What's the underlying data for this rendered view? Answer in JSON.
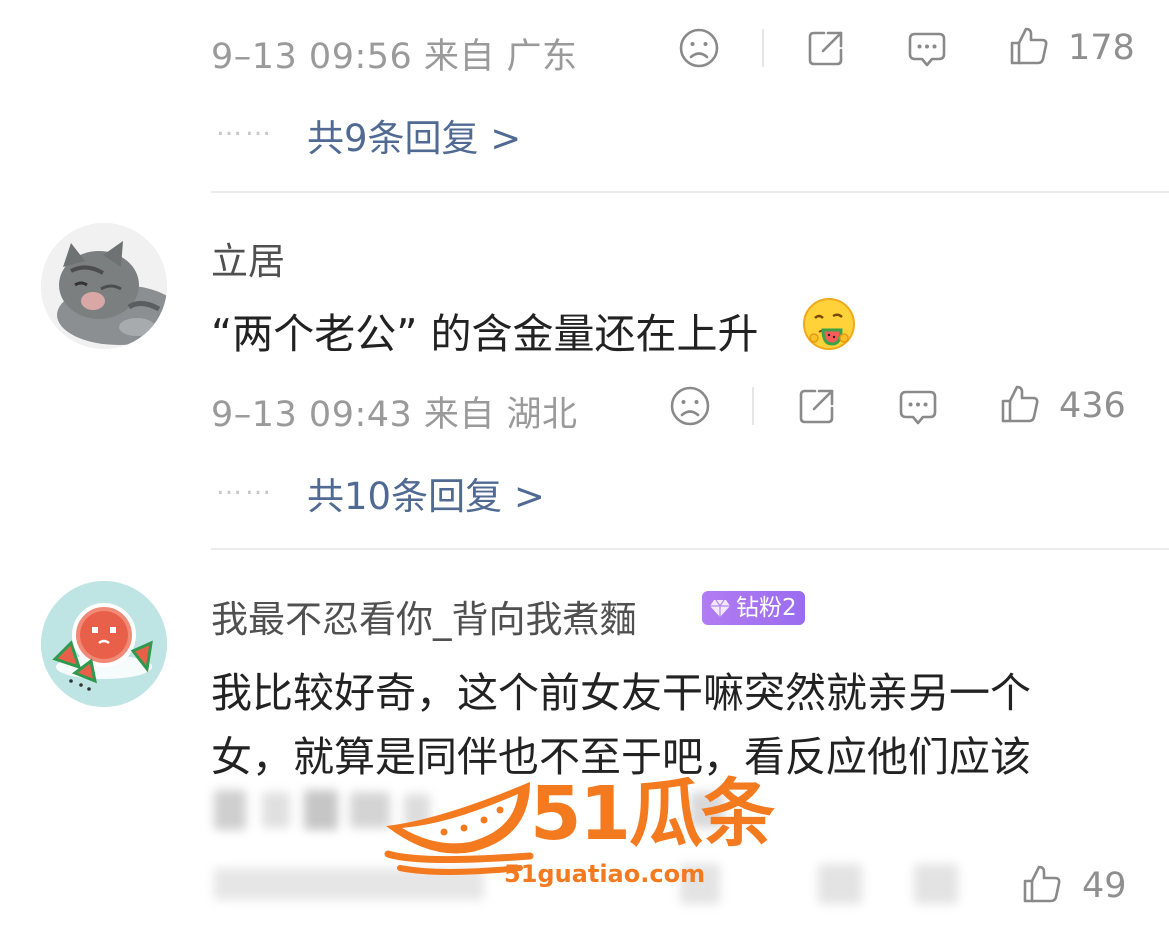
{
  "comments": [
    {
      "meta": "9–13 09:56 来自 广东",
      "like_count": "178",
      "replies_label": "共9条回复 >",
      "dots": "……"
    },
    {
      "username": "立居",
      "content": "“两个老公” 的含金量还在上升",
      "emoji": "watermelon-eating-emoji",
      "meta": "9–13 09:43 来自 湖北",
      "like_count": "436",
      "replies_label": "共10条回复 >",
      "dots": "……"
    },
    {
      "username": "我最不忍看你_背向我煮麵",
      "badge": "钻粉2",
      "content_line1": "我比较好奇，这个前女友干嘛突然就亲另一个",
      "content_line2": "女，就算是同伴也不至于吧，看反应他们应该",
      "like_count": "49"
    }
  ],
  "icons": {
    "dislike": "frown-face-icon",
    "share": "share-icon",
    "comment": "comment-icon",
    "like": "thumbs-up-icon"
  },
  "watermark": {
    "brand": "51瓜条",
    "url": "51guatiao.com"
  },
  "colors": {
    "accent_link": "#506a93",
    "meta_gray": "#9a9a9a",
    "badge_purple": "#a274f1",
    "watermark_orange": "#f47a20"
  }
}
